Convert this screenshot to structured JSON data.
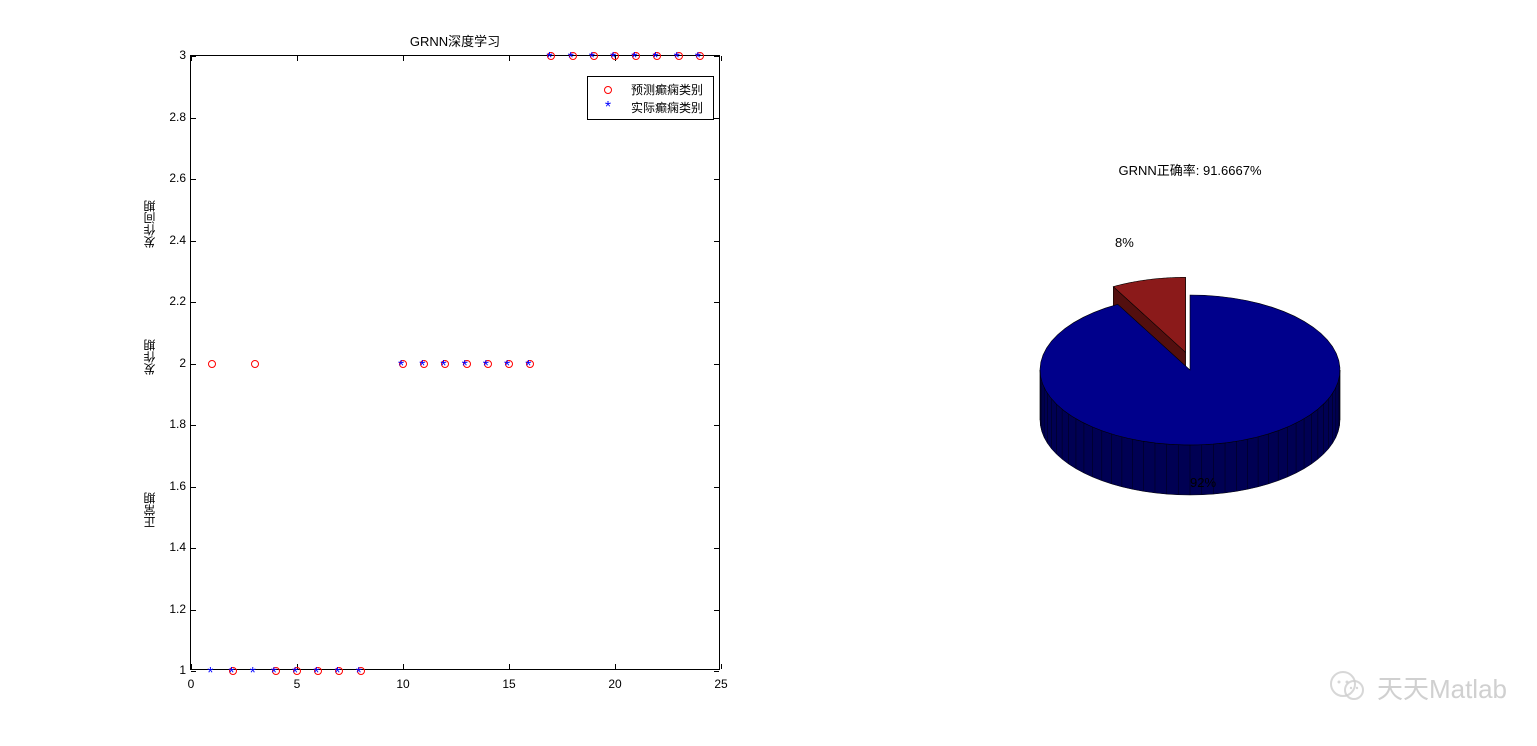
{
  "chart_data": [
    {
      "type": "scatter",
      "title": "GRNN深度学习",
      "xlabel": "",
      "ylabel_segments": [
        "正常期",
        "发作期",
        "发作间期"
      ],
      "xlim": [
        0,
        25
      ],
      "ylim": [
        1,
        3
      ],
      "x_ticks": [
        0,
        5,
        10,
        15,
        20,
        25
      ],
      "y_ticks": [
        1,
        1.2,
        1.4,
        1.6,
        1.8,
        2,
        2.2,
        2.4,
        2.6,
        2.8,
        3
      ],
      "legend": [
        "预测癫痫类别",
        "实际癫痫类别"
      ],
      "series": [
        {
          "name": "预测癫痫类别",
          "marker": "circle",
          "color": "#ff0000",
          "x": [
            1,
            2,
            3,
            4,
            5,
            6,
            7,
            8,
            10,
            11,
            12,
            13,
            14,
            15,
            16,
            17,
            18,
            19,
            20,
            21,
            22,
            23,
            24
          ],
          "y": [
            2,
            1,
            2,
            1,
            1,
            1,
            1,
            1,
            2,
            2,
            2,
            2,
            2,
            2,
            2,
            3,
            3,
            3,
            3,
            3,
            3,
            3,
            3
          ]
        },
        {
          "name": "实际癫痫类别",
          "marker": "star",
          "color": "#0000ff",
          "x": [
            1,
            2,
            3,
            4,
            5,
            6,
            7,
            8,
            10,
            11,
            12,
            13,
            14,
            15,
            16,
            17,
            18,
            19,
            20,
            21,
            22,
            23,
            24
          ],
          "y": [
            1,
            1,
            1,
            1,
            1,
            1,
            1,
            1,
            2,
            2,
            2,
            2,
            2,
            2,
            2,
            3,
            3,
            3,
            3,
            3,
            3,
            3,
            3
          ]
        }
      ]
    },
    {
      "type": "pie",
      "title": "GRNN正确率: 91.6667%",
      "slices": [
        {
          "label": "8%",
          "value": 8,
          "color": "#8b1a1a",
          "exploded": true
        },
        {
          "label": "92%",
          "value": 92,
          "color": "#00008b",
          "exploded": false
        }
      ]
    }
  ],
  "watermark": {
    "text": "天天Matlab"
  }
}
